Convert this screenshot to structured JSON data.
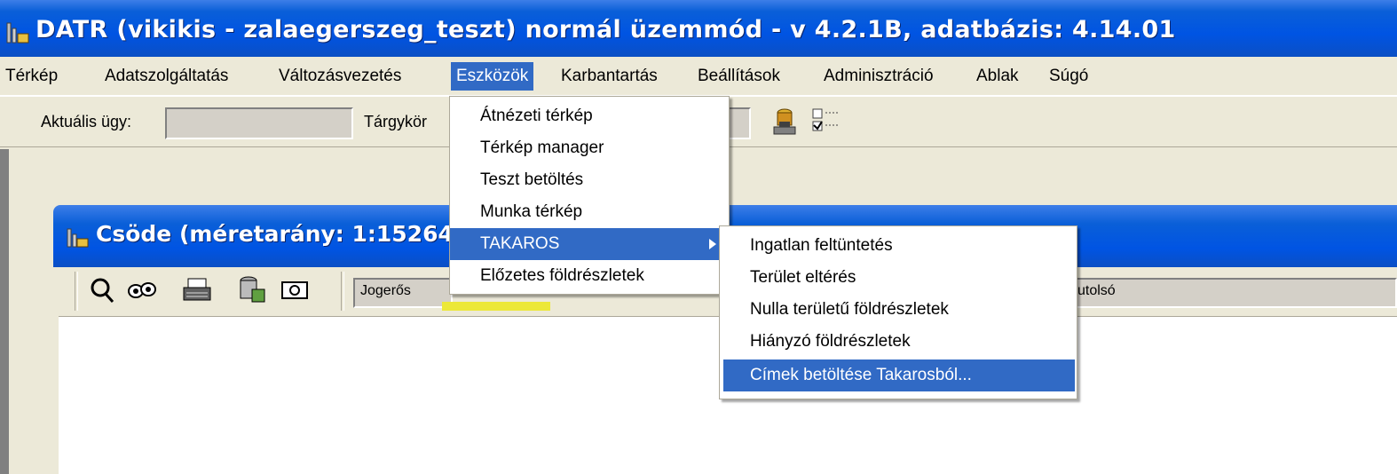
{
  "window": {
    "title": "DATR (vikikis - zalaegerszeg_teszt) normál üzemmód - v 4.2.1B, adatbázis: 4.14.01"
  },
  "menubar": {
    "items": [
      {
        "label": "Térkép"
      },
      {
        "label": "Adatszolgáltatás"
      },
      {
        "label": "Változásvezetés"
      },
      {
        "label": "Eszközök",
        "active": true
      },
      {
        "label": "Karbantartás"
      },
      {
        "label": "Beállítások"
      },
      {
        "label": "Adminisztráció"
      },
      {
        "label": "Ablak"
      },
      {
        "label": "Súgó"
      }
    ]
  },
  "toolbar": {
    "aktualis_label": "Aktuális ügy:",
    "aktualis_value": "",
    "targykor_label": "Tárgykör"
  },
  "eszkozok_menu": {
    "items": [
      {
        "label": "Átnézeti térkép"
      },
      {
        "label": "Térkép manager"
      },
      {
        "label": "Teszt betöltés"
      },
      {
        "label": "Munka térkép"
      },
      {
        "label": "TAKAROS",
        "submenu": true,
        "highlighted": true
      },
      {
        "label": "Előzetes földrészletek"
      }
    ]
  },
  "takaros_menu": {
    "items": [
      {
        "label": "Ingatlan feltüntetés"
      },
      {
        "label": "Terület eltérés"
      },
      {
        "label": "Nulla területű földrészletek"
      },
      {
        "label": "Hiányzó földrészletek"
      },
      {
        "label": "Címek betöltése Takarosból...",
        "highlighted": true
      }
    ]
  },
  "child_window": {
    "title": "Csöde  (méretarány: 1:15264",
    "toolbar": {
      "jogeros_label": "Jogerős",
      "utolso_label": "utolsó"
    }
  },
  "colors": {
    "titlebar": "#0054e3",
    "highlight": "#316ac5",
    "face": "#ece9d8"
  }
}
